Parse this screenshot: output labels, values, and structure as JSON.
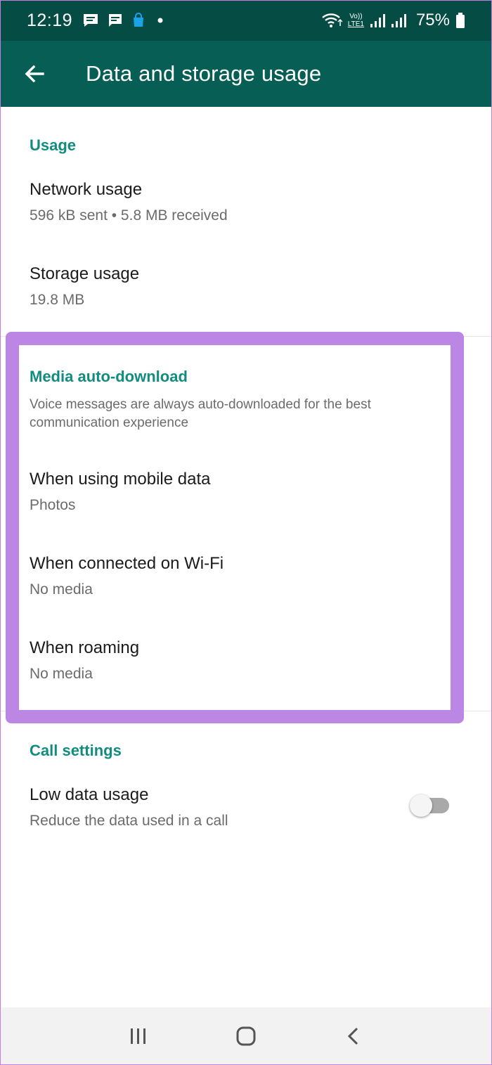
{
  "status_bar": {
    "time": "12:19",
    "notification_icons": [
      "message-icon",
      "chat-icon",
      "shopping-bag-icon",
      "dot-icon"
    ],
    "network_label_top": "Vo))",
    "network_label_bottom": "LTE1",
    "battery_percent": "75%"
  },
  "app_bar": {
    "title": "Data and storage usage",
    "back_icon": "arrow-left-icon",
    "color": "#075e54"
  },
  "sections": {
    "usage": {
      "header": "Usage",
      "network_usage": {
        "title": "Network usage",
        "subtitle": "596 kB sent • 5.8 MB received"
      },
      "storage_usage": {
        "title": "Storage usage",
        "subtitle": "19.8 MB"
      }
    },
    "media_auto_download": {
      "header": "Media auto-download",
      "note": "Voice messages are always auto-downloaded for the best communication experience",
      "mobile_data": {
        "title": "When using mobile data",
        "subtitle": "Photos"
      },
      "wifi": {
        "title": "When connected on Wi-Fi",
        "subtitle": "No media"
      },
      "roaming": {
        "title": "When roaming",
        "subtitle": "No media"
      }
    },
    "call_settings": {
      "header": "Call settings",
      "low_data_usage": {
        "title": "Low data usage",
        "subtitle": "Reduce the data used in a call",
        "enabled": false
      }
    }
  },
  "highlight_color": "#bc86e5",
  "accent_color": "#128c7e",
  "nav_bar": {
    "icons": [
      "recent-apps-icon",
      "home-icon",
      "back-icon"
    ]
  }
}
